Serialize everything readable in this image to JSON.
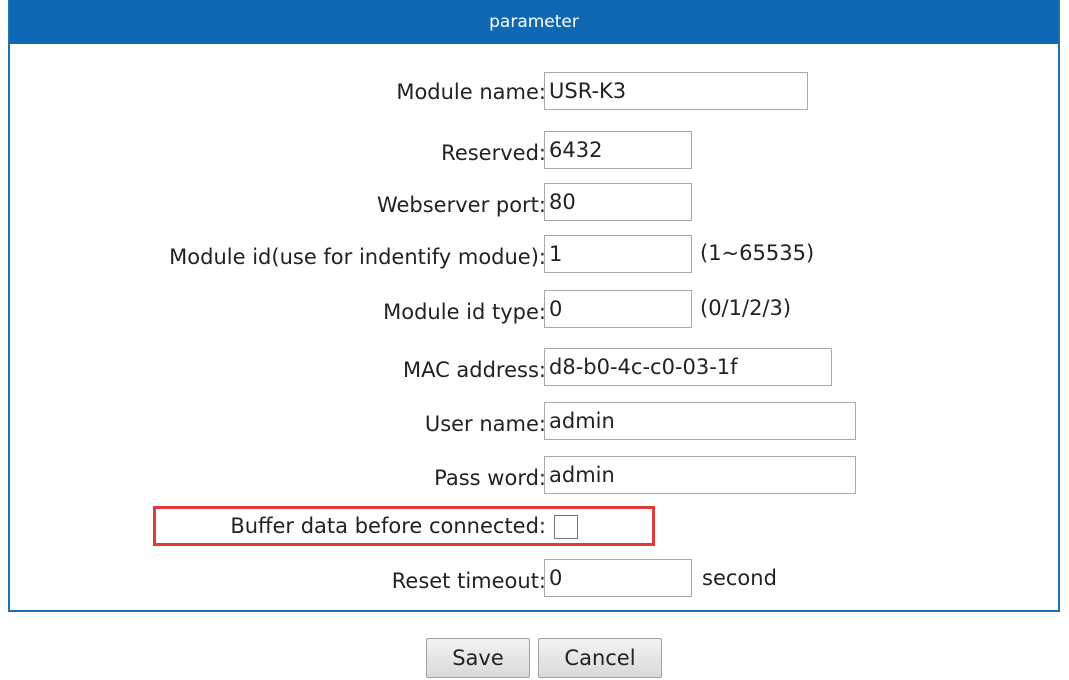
{
  "header": {
    "title": "parameter"
  },
  "fields": {
    "module_name": {
      "label": "Module name:",
      "value": "USR-K3"
    },
    "reserved": {
      "label": "Reserved:",
      "value": "6432"
    },
    "webserver_port": {
      "label": "Webserver port:",
      "value": "80"
    },
    "module_id": {
      "label": "Module id(use for indentify modue):",
      "value": "1",
      "hint": "(1~65535)"
    },
    "module_id_type": {
      "label": "Module id type:",
      "value": "0",
      "hint": "(0/1/2/3)"
    },
    "mac_address": {
      "label": "MAC address:",
      "value": "d8-b0-4c-c0-03-1f"
    },
    "user_name": {
      "label": "User name:",
      "value": "admin"
    },
    "password": {
      "label": "Pass word:",
      "value": "admin"
    },
    "buffer_data": {
      "label": "Buffer data before connected:",
      "checked": false
    },
    "reset_timeout": {
      "label": "Reset timeout:",
      "value": "0",
      "hint": "second"
    }
  },
  "buttons": {
    "save": "Save",
    "cancel": "Cancel"
  },
  "colors": {
    "header": "#0e68b3",
    "highlight": "#e03a3a"
  }
}
